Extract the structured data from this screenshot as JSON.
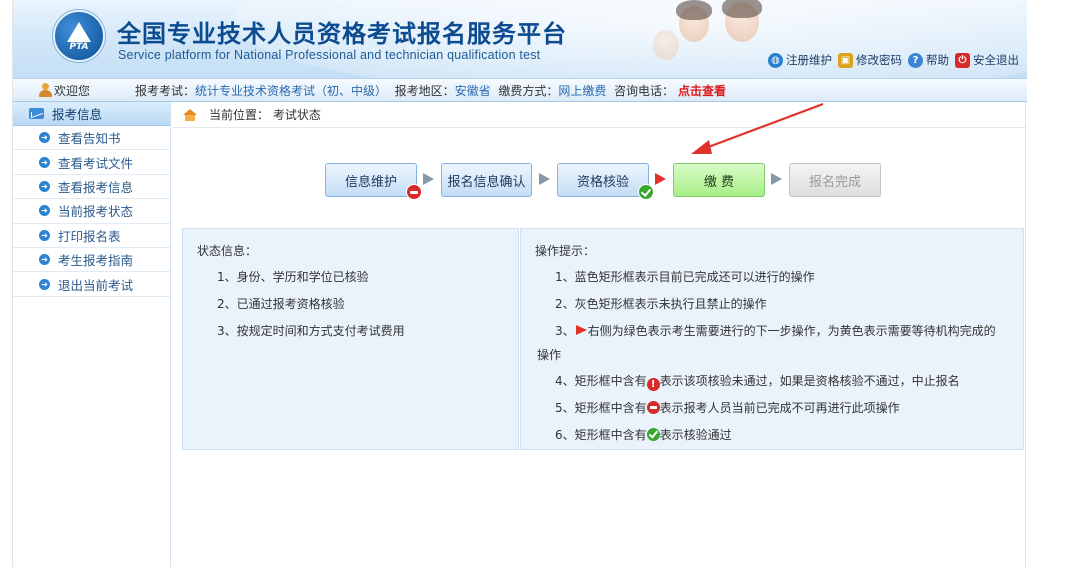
{
  "header": {
    "logo_text": "PTA",
    "title": "全国专业技术人员资格考试报名服务平台",
    "subtitle": "Service platform for National Professional and technician qualification test",
    "links": [
      {
        "label": "注册维护",
        "icon": "globe-icon",
        "color": "#2a7fd0"
      },
      {
        "label": "修改密码",
        "icon": "lock-icon",
        "color": "#d9a21c"
      },
      {
        "label": "帮助",
        "icon": "help-icon",
        "color": "#3a86d4"
      },
      {
        "label": "安全退出",
        "icon": "power-icon",
        "color": "#d92a2a"
      }
    ]
  },
  "infobar": {
    "welcome": "欢迎您",
    "exam_label": "报考考试：",
    "exam_value": "统计专业技术资格考试（初、中级）",
    "region_label": "报考地区：",
    "region_value": "安徽省",
    "payment_label": "缴费方式：",
    "payment_value": "网上缴费",
    "phone_label": "咨询电话：",
    "phone_link": "点击查看"
  },
  "sidebar": {
    "header": "报考信息",
    "items": [
      {
        "label": "查看告知书"
      },
      {
        "label": "查看考试文件"
      },
      {
        "label": "查看报考信息"
      },
      {
        "label": "当前报考状态"
      },
      {
        "label": "打印报名表"
      },
      {
        "label": "考生报考指南"
      },
      {
        "label": "退出当前考试"
      }
    ]
  },
  "breadcrumb": {
    "label": "当前位置：",
    "value": "考试状态"
  },
  "steps": [
    {
      "label": "信息维护",
      "state": "blue",
      "badge": "minus"
    },
    {
      "label": "报名信息确认",
      "state": "blue",
      "badge": ""
    },
    {
      "label": "资格核验",
      "state": "blue",
      "badge": "check"
    },
    {
      "label": "缴 费",
      "state": "green",
      "badge": ""
    },
    {
      "label": "报名完成",
      "state": "gray",
      "badge": ""
    }
  ],
  "status_panel": {
    "title": "状态信息：",
    "lines": [
      "1、身份、学历和学位已核验",
      "2、已通过报考资格核验",
      "3、按规定时间和方式支付考试费用"
    ]
  },
  "tips_panel": {
    "title": "操作提示：",
    "line1": "1、蓝色矩形框表示目前已完成还可以进行的操作",
    "line2": "2、灰色矩形框表示未执行且禁止的操作",
    "line3_prefix": "3、",
    "line3_text": "右侧为绿色表示考生需要进行的下一步操作，为黄色表示需要等待机构完成的",
    "line3_cont": "操作",
    "line4_prefix": "4、矩形框中含有",
    "line4_text": "表示该项核验未通过，如果是资格核验不通过，中止报名",
    "line5_prefix": "5、矩形框中含有",
    "line5_text": "表示报考人员当前已完成不可再进行此项操作",
    "line6_prefix": "6、矩形框中含有",
    "line6_text": "表示核验通过"
  },
  "colors": {
    "brand": "#0c4b8f",
    "link_red": "#e0191b",
    "step_blue": "#c3ddf5",
    "step_green": "#a7ee86",
    "step_gray": "#dedede"
  }
}
